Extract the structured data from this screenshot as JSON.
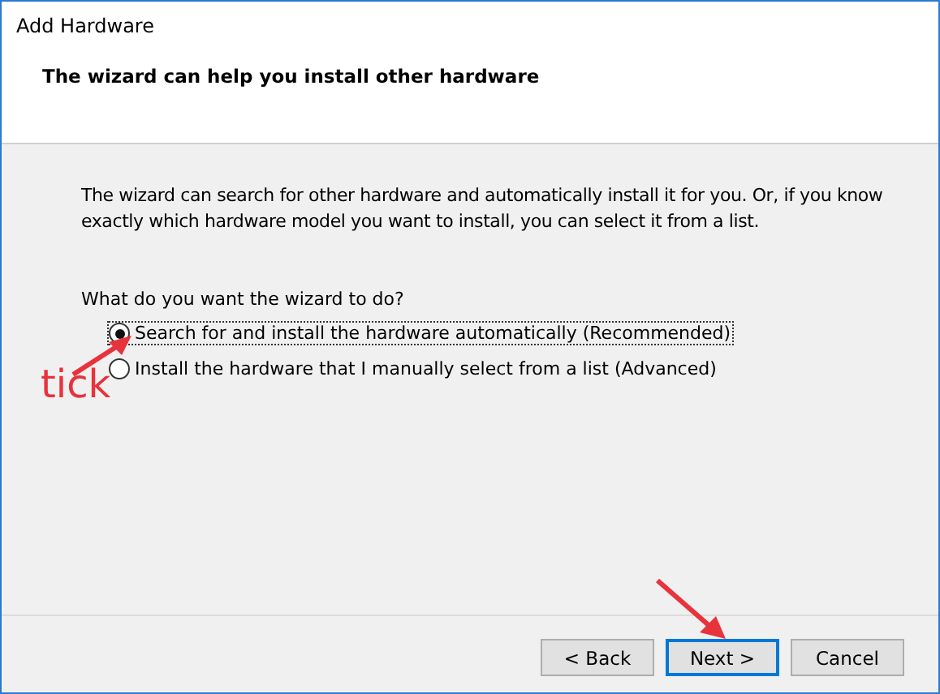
{
  "window": {
    "title": "Add Hardware"
  },
  "header": {
    "heading": "The wizard can help you install other hardware"
  },
  "intro": "The wizard can search for other hardware and automatically install it for you. Or, if you know exactly which hardware model you want to install, you can select it from a list.",
  "question": "What do you want the wizard to do?",
  "options": [
    {
      "label": "Search for and install the hardware automatically (Recommended)",
      "selected": true
    },
    {
      "label": "Install the hardware that I manually select from a list (Advanced)",
      "selected": false
    }
  ],
  "annotation": {
    "text": "tick"
  },
  "buttons": [
    {
      "label": "< Back",
      "default": false
    },
    {
      "label": "Next >",
      "default": true
    },
    {
      "label": "Cancel",
      "default": false
    }
  ]
}
